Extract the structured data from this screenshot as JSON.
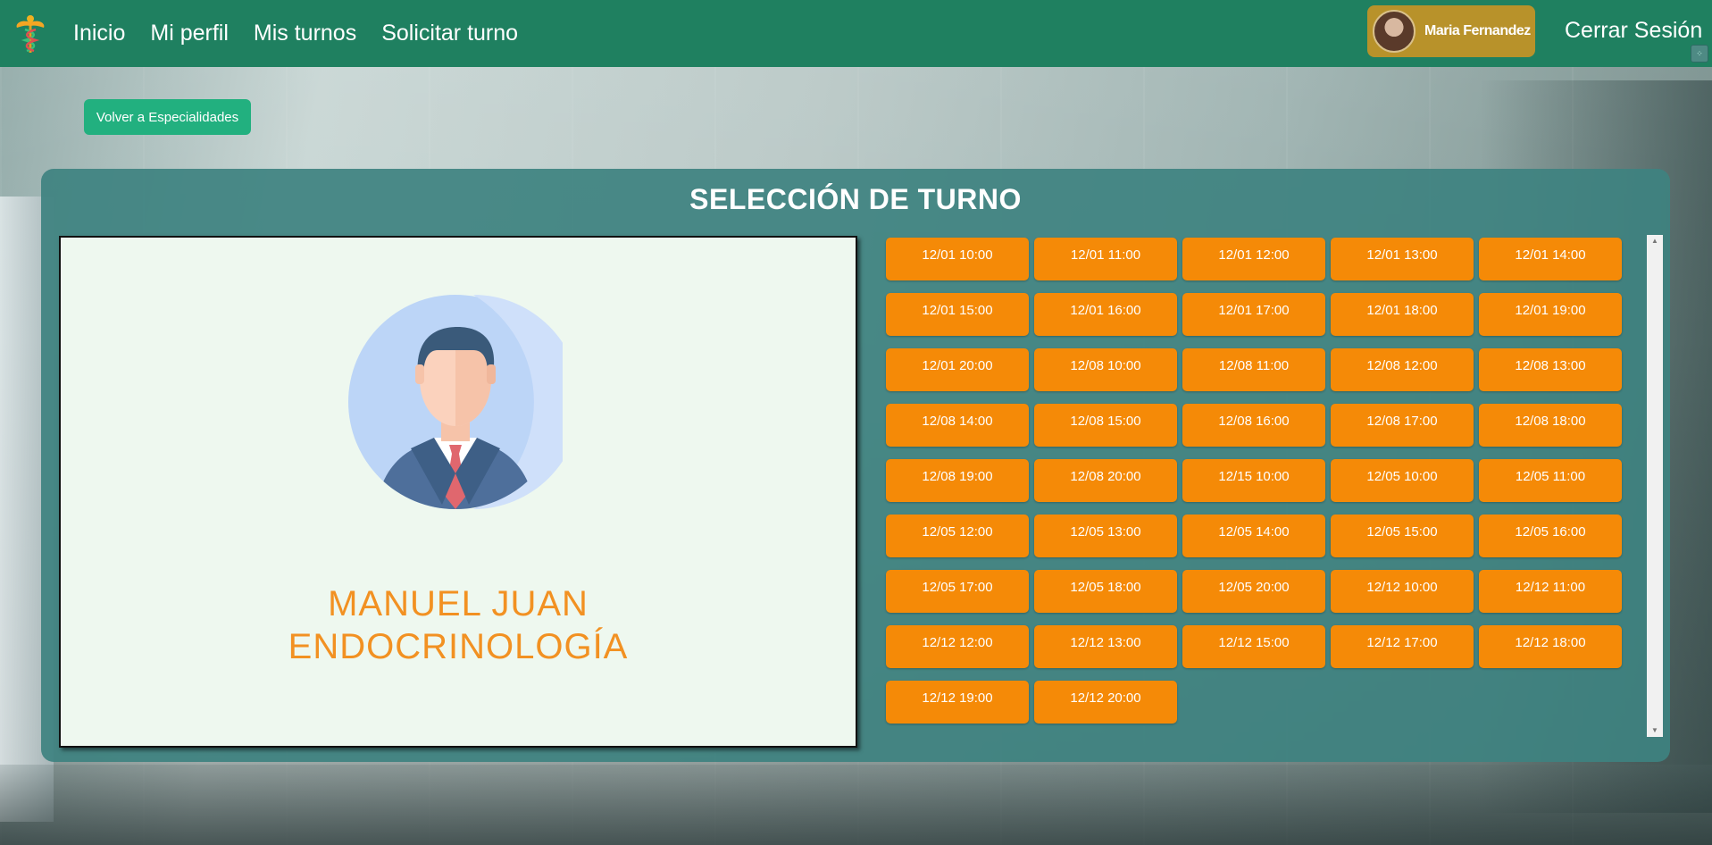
{
  "nav": {
    "logo_icon": "caduceus-icon",
    "links": [
      "Inicio",
      "Mi perfil",
      "Mis turnos",
      "Solicitar turno"
    ],
    "user_name": "Maria Fernandez",
    "logout": "Cerrar Sesión",
    "bg_color": "#1f8060",
    "user_chip_color": "#b8922a"
  },
  "back_button": "Volver a Especialidades",
  "panel": {
    "title": "SELECCIÓN DE TURNO",
    "doctor": {
      "name": "MANUEL JUAN",
      "specialty": "ENDOCRINOLOGÍA",
      "avatar_icon": "doctor-avatar-icon"
    },
    "slots": [
      "12/01 10:00",
      "12/01 11:00",
      "12/01 12:00",
      "12/01 13:00",
      "12/01 14:00",
      "12/01 15:00",
      "12/01 16:00",
      "12/01 17:00",
      "12/01 18:00",
      "12/01 19:00",
      "12/01 20:00",
      "12/08 10:00",
      "12/08 11:00",
      "12/08 12:00",
      "12/08 13:00",
      "12/08 14:00",
      "12/08 15:00",
      "12/08 16:00",
      "12/08 17:00",
      "12/08 18:00",
      "12/08 19:00",
      "12/08 20:00",
      "12/15 10:00",
      "12/05 10:00",
      "12/05 11:00",
      "12/05 12:00",
      "12/05 13:00",
      "12/05 14:00",
      "12/05 15:00",
      "12/05 16:00",
      "12/05 17:00",
      "12/05 18:00",
      "12/05 20:00",
      "12/12 10:00",
      "12/12 11:00",
      "12/12 12:00",
      "12/12 13:00",
      "12/12 15:00",
      "12/12 17:00",
      "12/12 18:00",
      "12/12 19:00",
      "12/12 20:00"
    ],
    "slot_color": "#f58a07",
    "accent_text_color": "#f29122"
  }
}
